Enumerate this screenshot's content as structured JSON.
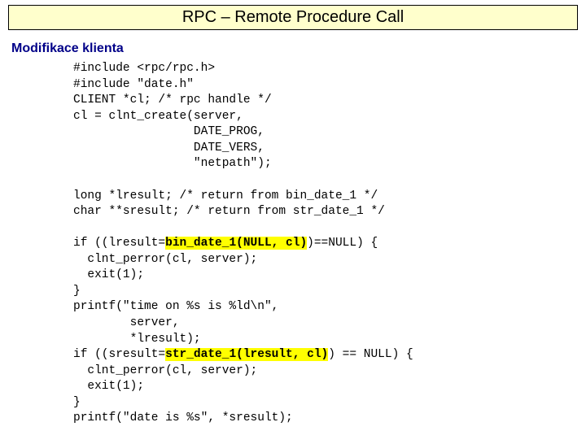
{
  "title": "RPC – Remote Procedure Call",
  "subtitle": "Modifikace klienta",
  "code": {
    "l1": "#include <rpc/rpc.h>",
    "l2": "#include \"date.h\"",
    "l3": "CLIENT *cl; /* rpc handle */",
    "l4": "cl = clnt_create(server,",
    "l5": "                 DATE_PROG,",
    "l6": "                 DATE_VERS,",
    "l7": "                 \"netpath\");",
    "l8": "",
    "l9": "long *lresult; /* return from bin_date_1 */",
    "l10": "char **sresult; /* return from str_date_1 */",
    "l11": "",
    "l12a": "if ((lresult=",
    "l12b": "bin_date_1(NULL, cl)",
    "l12c": ")==NULL) {",
    "l13": "  clnt_perror(cl, server);",
    "l14": "  exit(1);",
    "l15": "}",
    "l16": "printf(\"time on %s is %ld\\n\",",
    "l17": "        server,",
    "l18": "        *lresult);",
    "l19a": "if ((sresult=",
    "l19b": "str_date_1(lresult, cl)",
    "l19c": ") == NULL) {",
    "l20": "  clnt_perror(cl, server);",
    "l21": "  exit(1);",
    "l22": "}",
    "l23": "printf(\"date is %s\", *sresult);"
  }
}
